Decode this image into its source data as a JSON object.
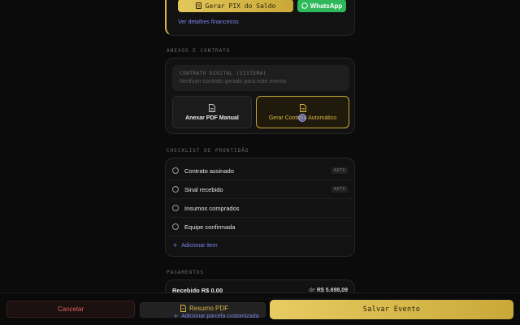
{
  "financial": {
    "pix_button": "Gerar PIX do Saldo",
    "whatsapp_button": "WhatsApp",
    "details_link": "Ver detalhes financeiros"
  },
  "attachments": {
    "section_title": "ANEXOS E CONTRATO",
    "field_label": "CONTRATO DIGITAL (SISTEMA)",
    "field_value": "Nenhum contrato gerado para este evento",
    "manual_button": "Anexar PDF Manual",
    "auto_button": "Gerar Contrato Automático"
  },
  "checklist": {
    "section_title": "CHECKLIST DE PRONTIDÃO",
    "items": [
      {
        "label": "Contrato assinado",
        "badge": "AUTO"
      },
      {
        "label": "Sinal recebido",
        "badge": "AUTO"
      },
      {
        "label": "Insumos comprados",
        "badge": ""
      },
      {
        "label": "Equipe confirmada",
        "badge": ""
      }
    ],
    "add_item": "Adicionar item"
  },
  "payments": {
    "section_title": "PAGAMENTOS",
    "received": "Recebido R$ 0,00",
    "total_prefix": "de",
    "total_value": "R$ 5.698,09",
    "add_installment": "Adicionar parcela customizada"
  },
  "footer": {
    "cancel": "Cancelar",
    "summary_pdf": "Resumo PDF",
    "save": "Salvar Evento"
  },
  "colors": {
    "accent_gold": "#d8b743",
    "link_blue": "#7a84e8",
    "whatsapp_green": "#2fb85a",
    "danger_red": "#e0605a"
  }
}
